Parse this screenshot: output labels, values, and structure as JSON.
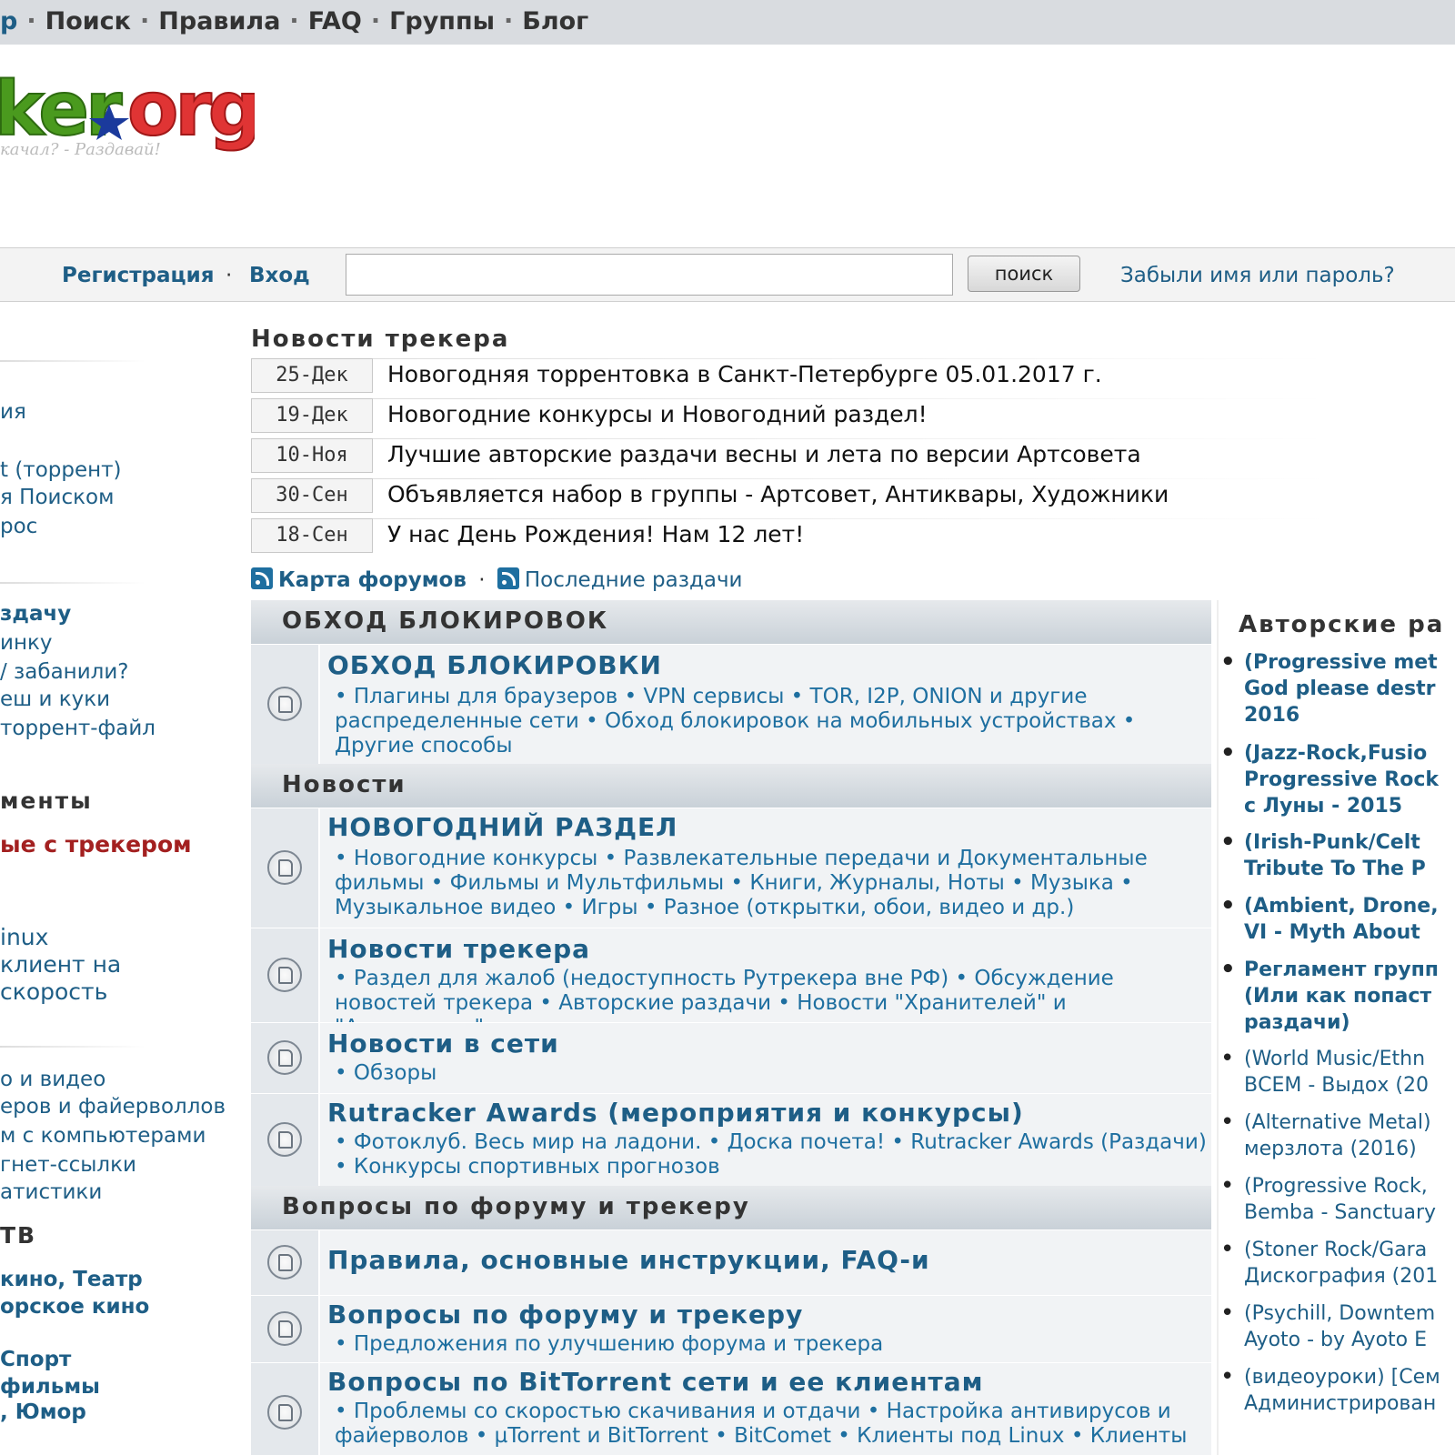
{
  "topnav": {
    "items": [
      "р",
      "Поиск",
      "Правила",
      "FAQ",
      "Группы",
      "Блог"
    ]
  },
  "logo": {
    "text": "ker.org",
    "slogan": "качал? - Раздавай!"
  },
  "loginbar": {
    "register": "Регистрация",
    "sep": "·",
    "login": "Вход",
    "search_button": "поиск",
    "forgot": "Забыли имя или пароль?"
  },
  "left": {
    "items": [
      {
        "text": "ия",
        "style": "normal"
      },
      {
        "text": "t (торрент)",
        "style": "normal"
      },
      {
        "text": "я Поиском",
        "style": "normal"
      },
      {
        "text": "рос",
        "style": "normal"
      },
      {
        "text": "здачу",
        "style": "bold"
      },
      {
        "text": "инку",
        "style": "normal"
      },
      {
        "text": "/ забанили?",
        "style": "normal"
      },
      {
        "text": "еш и куки",
        "style": "normal"
      },
      {
        "text": "торрент-файл",
        "style": "normal"
      },
      {
        "text": "менты",
        "style": "heading"
      },
      {
        "text": "ые с трекером",
        "style": "red"
      },
      {
        "text": "inux",
        "style": "normal"
      },
      {
        "text": "клиент на",
        "style": "normal"
      },
      {
        "text": "скорость",
        "style": "normal"
      },
      {
        "text": "о и видео",
        "style": "normal"
      },
      {
        "text": "еров и файерволлов",
        "style": "normal"
      },
      {
        "text": "м с компьютерами",
        "style": "normal"
      },
      {
        "text": "гнет-ссылки",
        "style": "normal"
      },
      {
        "text": "атистики",
        "style": "normal"
      },
      {
        "text": "ТВ",
        "style": "heading"
      },
      {
        "text": "кино, Театр",
        "style": "bold"
      },
      {
        "text": "орское кино",
        "style": "bold"
      },
      {
        "text": "Спорт",
        "style": "bold"
      },
      {
        "text": "фильмы",
        "style": "bold"
      },
      {
        "text": ", Юмор",
        "style": "bold"
      }
    ]
  },
  "news": {
    "title": "Новости трекера",
    "items": [
      {
        "date": "25-Дек",
        "text": "Новогодняя торрентовка в Санкт-Петербурге 05.01.2017 г."
      },
      {
        "date": "19-Дек",
        "text": "Новогодние конкурсы и Новогодний раздел!"
      },
      {
        "date": "10-Ноя",
        "text": "Лучшие авторские раздачи весны и лета по версии Артсовета"
      },
      {
        "date": "30-Сен",
        "text": "Объявляется набор в группы - Артсовет, Антиквары, Художники"
      },
      {
        "date": "18-Сен",
        "text": "У нас День Рождения! Нам 12 лет!"
      }
    ]
  },
  "maplinks": {
    "forum_map": "Карта форумов",
    "sep": "·",
    "latest": "Последние раздачи"
  },
  "forum": {
    "cat1": "ОБХОД БЛОКИРОВОК",
    "f1_title": "ОБХОД БЛОКИРОВКИ",
    "f1_sub": "• Плагины для браузеров • VPN сервисы • TOR, I2P, ONION и другие распределенные сети • Обход блокировок на мобильных устройствах • Другие способы",
    "cat2": "Новости",
    "f2_title": "НОВОГОДНИЙ РАЗДЕЛ",
    "f2_sub": "• Новогодние конкурсы • Развлекательные передачи и Документальные фильмы • Фильмы и Мультфильмы • Книги, Журналы, Ноты • Музыка • Музыкальное видео • Игры • Разное (открытки, обои, видео и др.)",
    "f3_title": "Новости трекера",
    "f3_sub": "• Раздел для жалоб (недоступность Рутрекера вне РФ) • Обсуждение новостей трекера • Авторские раздачи • Новости \"Хранителей\" и \"Антикваров\"",
    "f4_title": "Новости в сети",
    "f4_sub": "• Обзоры",
    "f5_title": "Rutracker Awards (мероприятия и конкурсы)",
    "f5_sub": "• Фотоклуб. Весь мир на ладони. • Доска почета! • Rutracker Awards (Раздачи) • Конкурсы спортивных прогнозов",
    "cat3": "Вопросы по форуму и трекеру",
    "f6_title": "Правила, основные инструкции, FAQ-и",
    "f7_title": "Вопросы по форуму и трекеру",
    "f7_sub": "• Предложения по улучшению форума и трекера",
    "f8_title": "Вопросы по BitTorrent сети и ее клиентам",
    "f8_sub": "• Проблемы со скоростью скачивания и отдачи • Настройка антивирусов и файерволов • µTorrent и BitTorrent • BitComet • Клиенты под Linux • Клиенты"
  },
  "right": {
    "title": "Авторские ра",
    "items": [
      {
        "lines": [
          "(Progressive met",
          "God please destr",
          "2016"
        ],
        "bold": true
      },
      {
        "lines": [
          "(Jazz-Rock,Fusio",
          "Progressive Rock",
          "с Луны - 2015"
        ],
        "bold": true
      },
      {
        "lines": [
          "(Irish-Punk/Celt",
          "Tribute To The P"
        ],
        "bold": true
      },
      {
        "lines": [
          "(Ambient, Drone,",
          "VI - Myth About"
        ],
        "bold": true
      },
      {
        "lines": [
          "Регламент групп",
          "(Или как попаст",
          "раздачи)"
        ],
        "bold": true
      },
      {
        "lines": [
          "(World Music/Ethn",
          "ВСЕМ - Выдох (20"
        ],
        "bold": false
      },
      {
        "lines": [
          "(Alternative Metal)",
          "мерзлота (2016)"
        ],
        "bold": false
      },
      {
        "lines": [
          "(Progressive Rock,",
          "Bemba - Sanctuary"
        ],
        "bold": false
      },
      {
        "lines": [
          "(Stoner Rock/Gara",
          "Дискография (201"
        ],
        "bold": false
      },
      {
        "lines": [
          "(Psychill, Downtem",
          "Ayoto - by Ayoto E"
        ],
        "bold": false
      },
      {
        "lines": [
          "(видеоуроки) [Сем",
          "Администрирован"
        ],
        "bold": false
      }
    ]
  },
  "colors": {
    "link": "#1e5e86",
    "accent_red": "#a32020",
    "topnav_bg": "#d9dce0",
    "category_bg": "#c9d1d8"
  }
}
